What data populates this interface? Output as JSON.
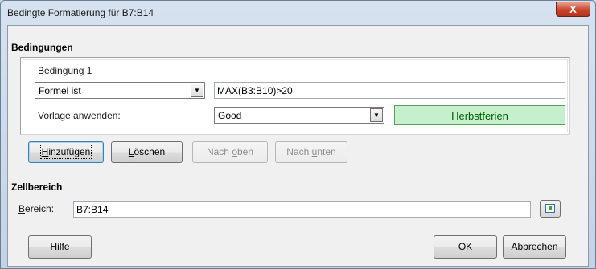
{
  "window": {
    "title": "Bedingte Formatierung für B7:B14",
    "close_glyph": "X"
  },
  "conditions": {
    "section_title": "Bedingungen",
    "condition_label": "Bedingung 1",
    "type_value": "Formel ist",
    "formula_value": "MAX(B3:B10)>20",
    "apply_style_label": "Vorlage anwenden:",
    "style_value": "Good",
    "preview_text": "Herbstferien",
    "dropdown_arrow": "▼"
  },
  "actions": {
    "add": {
      "pre": "",
      "mn": "H",
      "post": "inzufügen"
    },
    "delete": {
      "pre": "",
      "mn": "L",
      "post": "öschen"
    },
    "up": {
      "pre": "Nach ",
      "mn": "o",
      "post": "ben"
    },
    "down": {
      "pre": "Nach ",
      "mn": "u",
      "post": "nten"
    }
  },
  "cell_range": {
    "section_title": "Zellbereich",
    "label_mn": "B",
    "label_post": "ereich:",
    "value": "B7:B14"
  },
  "footer": {
    "help": {
      "mn": "H",
      "post": "ilfe"
    },
    "ok": "OK",
    "cancel": "Abbrechen"
  },
  "colors": {
    "preview_bg": "#c6efce",
    "preview_text": "#006100",
    "close_button": "#c7452b"
  },
  "icons": {
    "range_picker": "shrink-range-icon"
  }
}
